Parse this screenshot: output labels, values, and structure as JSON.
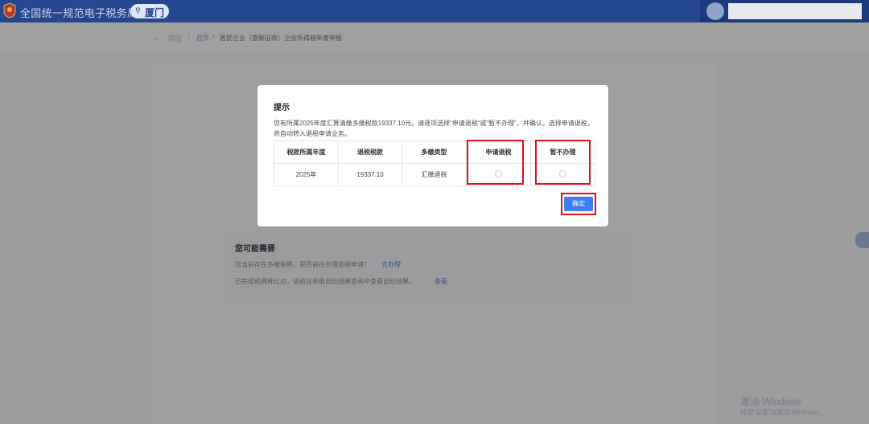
{
  "header": {
    "site_title": "全国统一规范电子税务局",
    "region": "厦门",
    "region_icon": "location-pin-icon"
  },
  "breadcrumb": {
    "back_label": "返回",
    "home": "首页",
    "separator": ">",
    "current": "居民企业（查账征收）企业所得税年度申报"
  },
  "suggestions": {
    "title": "您可能需要",
    "line1": "您当前存在多缴税费，是否前往办理退税申请？",
    "link1": "去办理",
    "line2": "已完成税费种比对，请前往申报自检结果查询中查看自检结果。",
    "link2": "查看"
  },
  "dialog": {
    "title": "提示",
    "message": "您有所属2025年度汇算清缴多缴税款19337.10元。请逐项选择“申请退税”或“暂不办理”，并确认。选择申请退税，将自动转入退税申请业务。",
    "columns": [
      "税款所属年度",
      "退税税款",
      "多缴类型",
      "申请退税",
      "暂不办理"
    ],
    "rows": [
      {
        "year": "2025年",
        "amount": "19337.10",
        "type": "汇缴退税",
        "apply_refund": false,
        "defer": false
      }
    ],
    "confirm_label": "确定"
  },
  "watermark": {
    "line1": "激活 Windows",
    "line2": "转到“设置”以激活 Windows。"
  },
  "colors": {
    "header_bg": "#25478f",
    "primary": "#3d7ef6",
    "highlight": "#e3101a"
  }
}
